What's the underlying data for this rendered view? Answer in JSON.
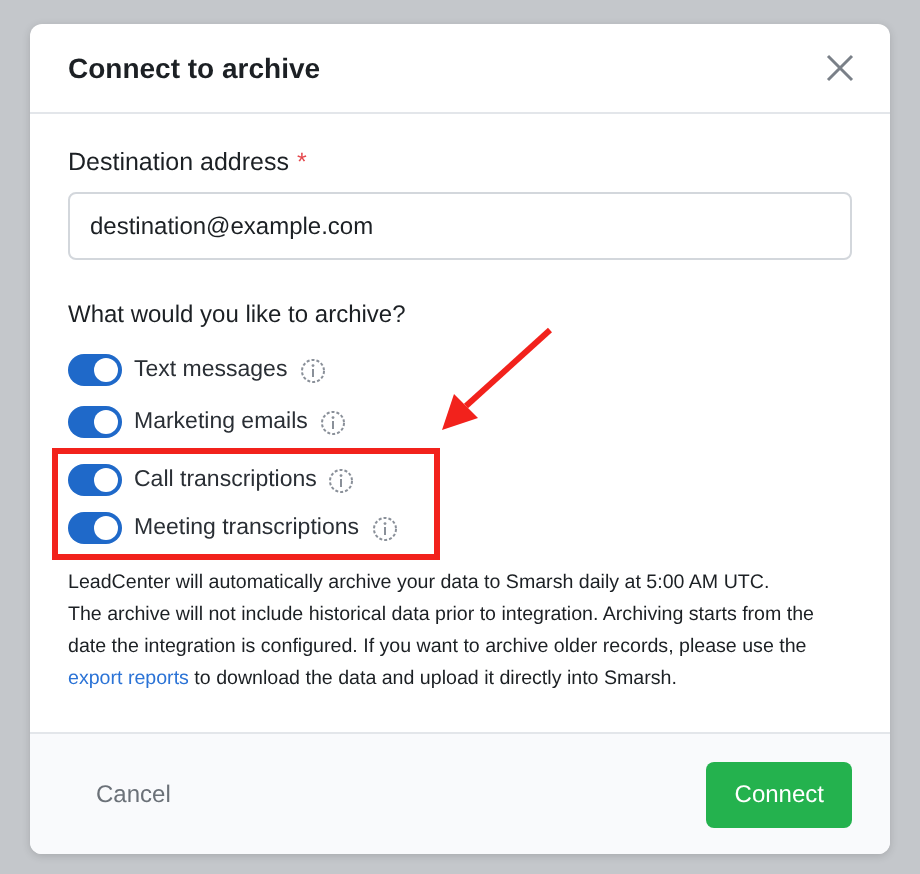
{
  "dialog": {
    "title": "Connect to archive",
    "destination": {
      "label": "Destination address",
      "required_mark": "*",
      "value": "destination@example.com"
    },
    "question": "What would you like to archive?",
    "options": [
      {
        "label": "Text messages",
        "on": true,
        "highlighted": false
      },
      {
        "label": "Marketing emails",
        "on": true,
        "highlighted": false
      },
      {
        "label": "Call transcriptions",
        "on": true,
        "highlighted": true
      },
      {
        "label": "Meeting transcriptions",
        "on": true,
        "highlighted": true
      }
    ],
    "notes": [
      {
        "before": "LeadCenter will automatically archive your data to Smarsh daily at 5:00 AM UTC."
      },
      {
        "before": "The archive will not include historical data prior to integration. Archiving starts from the date the integration is configured. If you want to archive older records, please use the ",
        "link": "export reports",
        "after": " to download the data and upload it directly into Smarsh."
      }
    ],
    "buttons": {
      "cancel": "Cancel",
      "confirm": "Connect"
    }
  }
}
